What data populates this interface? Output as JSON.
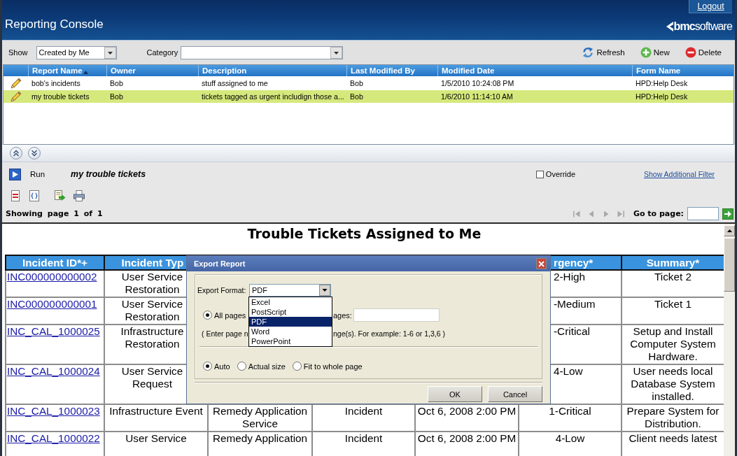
{
  "header": {
    "title": "Reporting Console",
    "logout": "Logout",
    "logo": "**bmc**software"
  },
  "toolbar": {
    "show_label": "Show",
    "show_value": "Created by Me",
    "category_label": "Category",
    "actions": [
      {
        "kind": "refresh",
        "label": "Refresh"
      },
      {
        "kind": "new",
        "label": "New"
      },
      {
        "kind": "delete",
        "label": "Delete"
      }
    ]
  },
  "report_list": {
    "columns": [
      {
        "label": "Report Name",
        "sorted": true
      },
      {
        "label": "Owner",
        "sorted": false
      },
      {
        "label": "Description",
        "sorted": false
      },
      {
        "label": "Last Modified By",
        "sorted": false
      },
      {
        "label": "Modified Date",
        "sorted": false
      },
      {
        "label": "Form Name",
        "sorted": false
      }
    ],
    "rows": [
      {
        "selected": false,
        "cells": [
          "bob's incidents",
          "Bob",
          "stuff assigned to me",
          "Bob",
          "1/5/2010 10:24:08 PM",
          "HPD:Help Desk"
        ]
      },
      {
        "selected": true,
        "cells": [
          "my trouble tickets",
          "Bob",
          "tickets tagged as urgent includign those a...",
          "Bob",
          "1/6/2010 11:14:10 AM",
          "HPD:Help Desk"
        ]
      }
    ]
  },
  "run_bar": {
    "run_label": "Run",
    "report_name": "my trouble tickets",
    "override": {
      "label": "Override",
      "checked": false
    },
    "filter_link": "Show Additional Filter"
  },
  "pager": {
    "status": "Showing page 1 of 1",
    "nav_buttons": [
      {
        "kind": "first",
        "disabled": true
      },
      {
        "kind": "previous",
        "disabled": true
      },
      {
        "kind": "next",
        "disabled": true
      },
      {
        "kind": "last",
        "disabled": true
      }
    ],
    "go_label": "Go to page:"
  },
  "report": {
    "title": "Trouble Tickets Assigned to Me",
    "header": {
      "incident_id": "Incident ID*+",
      "incident_type": "Incident Typ",
      "urgency": "rgency*",
      "summary": "Summary*"
    },
    "rows": [
      {
        "incident_id": "INC000000000002",
        "incident_type": "User Service Restoration",
        "urgency": "2-High",
        "summary": "Ticket 2"
      },
      {
        "incident_id": "INC000000000001",
        "incident_type": "User Service Restoration",
        "urgency": "-Medium",
        "summary": "Ticket 1"
      },
      {
        "incident_id": "INC_CAL_1000025",
        "incident_type": "Infrastructure Restoration",
        "urgency": "-Critical",
        "summary": "Setup and Install Computer System Hardware."
      },
      {
        "incident_id": "INC_CAL_1000024",
        "incident_type": "User Service Request",
        "urgency": "4-Low",
        "summary": "User needs local Database System installed."
      },
      {
        "incident_id": "INC_CAL_1000023",
        "incident_type": "Infrastructure Event",
        "column_3": "Remedy Application Service",
        "column_4": "Incident",
        "column_5": "Oct 6, 2008 2:00 PM",
        "urgency": "1-Critical",
        "summary": "Prepare System for Distribution."
      },
      {
        "incident_id": "INC_CAL_1000022",
        "incident_type": "User Service",
        "column_3": "Remedy Application",
        "column_4": "Incident",
        "column_5": "Oct 6, 2008 2:00 PM",
        "urgency": "4-Low",
        "summary": "Client needs latest"
      }
    ]
  },
  "dialog": {
    "title": "Export Report",
    "format_label": "Export Format:",
    "format_value": "PDF",
    "format_options": [
      {
        "label": "Excel",
        "selected": false
      },
      {
        "label": "PostScript",
        "selected": false
      },
      {
        "label": "PDF",
        "selected": true
      },
      {
        "label": "Word",
        "selected": false
      },
      {
        "label": "PowerPoint",
        "selected": false
      }
    ],
    "range_options": [
      {
        "label": "All pages",
        "selected": true
      }
    ],
    "range_label": "ages:",
    "hint": [
      "( Enter page n",
      "nge(s). For example: 1-6 or 1,3,6 )"
    ],
    "size_options": [
      {
        "label": "Auto",
        "selected": true
      },
      {
        "label": "Actual size",
        "selected": false
      },
      {
        "label": "Fit to whole page",
        "selected": false
      }
    ],
    "buttons": [
      "OK",
      "Cancel"
    ]
  }
}
